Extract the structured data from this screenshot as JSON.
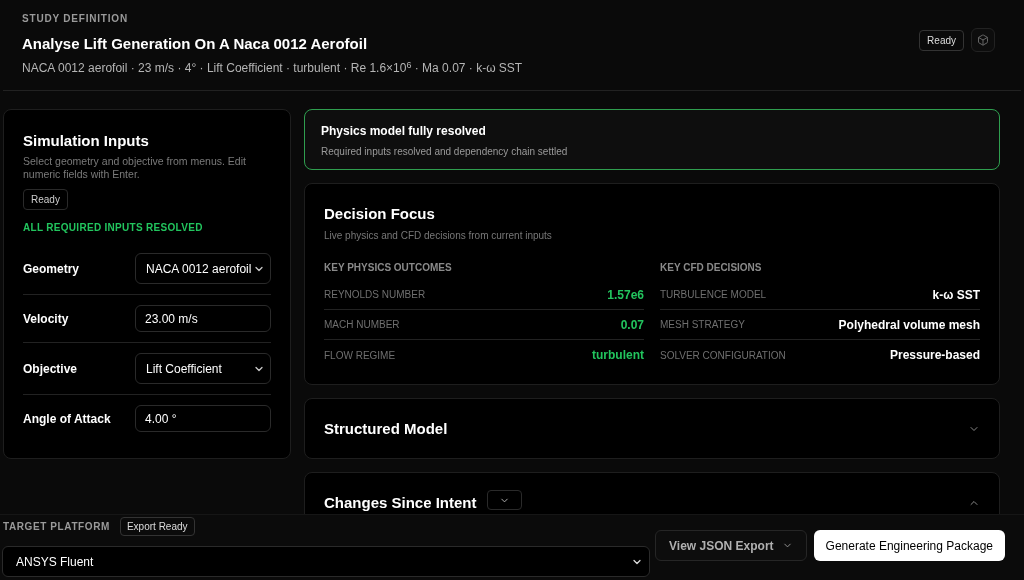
{
  "header": {
    "eyebrow": "STUDY DEFINITION",
    "title": "Analyse Lift Generation On A Naca 0012 Aerofoil",
    "summary": "NACA 0012 aerofoil · 23 m/s · 4° · Lift Coefficient · turbulent · Re 1.6×10$^{6}$ · Ma 0.07 · k-ω SST",
    "status": "Ready"
  },
  "inputs_panel": {
    "title": "Simulation Inputs",
    "description": "Select geometry and objective from menus. Edit numeric fields with Enter.",
    "status": "Ready",
    "resolution": "ALL REQUIRED INPUTS RESOLVED",
    "fields": [
      {
        "label": "Geometry",
        "kind": "select",
        "value": "NACA 0012 aerofoil"
      },
      {
        "label": "Velocity",
        "kind": "number",
        "value": "23.00 m/s"
      },
      {
        "label": "Objective",
        "kind": "select",
        "value": "Lift Coefficient"
      },
      {
        "label": "Angle of Attack",
        "kind": "number",
        "value": "4.00 °"
      }
    ]
  },
  "banner": {
    "title": "Physics model fully resolved",
    "message": "Required inputs resolved and dependency chain settled"
  },
  "decision_focus": {
    "title": "Decision Focus",
    "subtitle": "Live physics and CFD decisions from current inputs",
    "columns": [
      {
        "heading": "KEY PHYSICS OUTCOMES",
        "kind": "outcome",
        "rows": [
          {
            "label": "REYNOLDS NUMBER",
            "value": "1.57e6"
          },
          {
            "label": "MACH NUMBER",
            "value": "0.07"
          },
          {
            "label": "FLOW REGIME",
            "value": "turbulent"
          }
        ]
      },
      {
        "heading": "KEY CFD DECISIONS",
        "kind": "decision",
        "rows": [
          {
            "label": "TURBULENCE MODEL",
            "value": "k-ω SST"
          },
          {
            "label": "MESH STRATEGY",
            "value": "Polyhedral volume mesh"
          },
          {
            "label": "SOLVER CONFIGURATION",
            "value": "Pressure-based"
          }
        ]
      }
    ]
  },
  "sections": [
    {
      "title": "Structured Model",
      "expanded": false
    },
    {
      "title": "Changes Since Intent",
      "expanded": true
    }
  ],
  "footer": {
    "label": "TARGET PLATFORM",
    "status": "Export Ready",
    "platform": "ANSYS Fluent",
    "actions": [
      {
        "label": "View JSON Export",
        "kind": "secondary"
      },
      {
        "label": "Generate Engineering Package",
        "kind": "primary"
      }
    ]
  }
}
